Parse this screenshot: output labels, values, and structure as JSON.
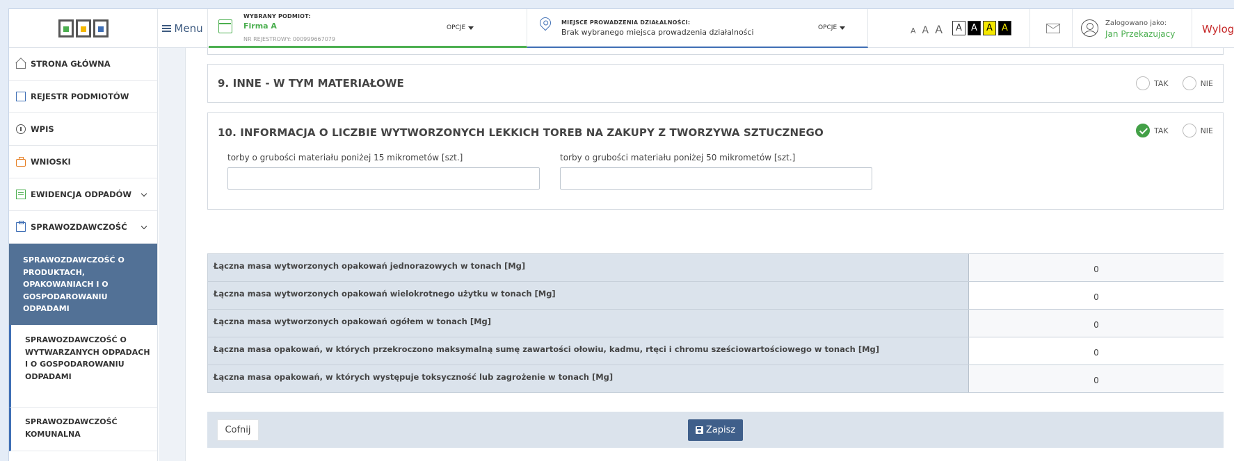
{
  "header": {
    "menu_label": "Menu",
    "podmiot": {
      "label": "WYBRANY PODMIOT:",
      "name": "Firma A",
      "nr": "NR REJESTROWY: 000999667079",
      "opcje": "OPCJE"
    },
    "miejsce": {
      "label": "MIEJSCE PROWADZENIA DZIAŁALNOŚCI:",
      "value": "Brak wybranego miejsca prowadzenia działalności",
      "opcje": "OPCJE"
    },
    "font_sizes": [
      "A",
      "A",
      "A"
    ],
    "contrast": [
      "A",
      "A",
      "A",
      "A"
    ],
    "logged_label": "Zalogowano jako:",
    "user_name": "Jan Przekazujacy",
    "logout": "Wyloguj"
  },
  "sidebar": {
    "items": [
      {
        "label": "STRONA GŁÓWNA"
      },
      {
        "label": "REJESTR PODMIOTÓW"
      },
      {
        "label": "WPIS"
      },
      {
        "label": "WNIOSKI"
      },
      {
        "label": "EWIDENCJA ODPADÓW"
      },
      {
        "label": "SPRAWOZDAWCZOŚĆ"
      }
    ],
    "sub_items": [
      {
        "label": "SPRAWOZDAWCZOŚĆ O PRODUKTACH, OPAKOWANIACH I O GOSPODAROWANIU ODPADAMI"
      },
      {
        "label": "SPRAWOZDAWCZOŚĆ O WYTWARZANYCH ODPADACH I O GOSPODAROWANIU ODPADAMI"
      },
      {
        "label": "SPRAWOZDAWCZOŚĆ KOMUNALNA"
      }
    ]
  },
  "sections": {
    "s9": {
      "title": "9. INNE - W TYM MATERIAŁOWE",
      "tak": "TAK",
      "nie": "NIE"
    },
    "s10": {
      "title": "10. INFORMACJA O LICZBIE WYTWORZONYCH LEKKICH TOREB NA ZAKUPY Z TWORZYWA SZTUCZNEGO",
      "tak": "TAK",
      "nie": "NIE",
      "field1_label": "torby o grubości materiału poniżej 15 mikrometów [szt.]",
      "field1_value": "",
      "field2_label": "torby o grubości materiału poniżej 50 mikrometów [szt.]",
      "field2_value": ""
    }
  },
  "summary": [
    {
      "label": "Łączna masa wytworzonych opakowań jednorazowych w tonach [Mg]",
      "value": "0"
    },
    {
      "label": "Łączna masa wytworzonych opakowań wielokrotnego użytku w tonach [Mg]",
      "value": "0"
    },
    {
      "label": "Łączna masa wytworzonych opakowań ogółem w tonach [Mg]",
      "value": "0"
    },
    {
      "label": "Łączna masa opakowań, w których przekroczono maksymalną sumę zawartości ołowiu, kadmu, rtęci i chromu sześciowartościowego w tonach [Mg]",
      "value": "0"
    },
    {
      "label": "Łączna masa opakowań, w których występuje toksyczność lub zagrożenie w tonach [Mg]",
      "value": "0"
    }
  ],
  "footer": {
    "back_label": "Cofnij",
    "save_label": "Zapisz"
  },
  "colors": {
    "accent_green": "#4caf50",
    "accent_blue": "#3f6fb5",
    "sidebar_active": "#527196",
    "logout_red": "#c62828"
  }
}
